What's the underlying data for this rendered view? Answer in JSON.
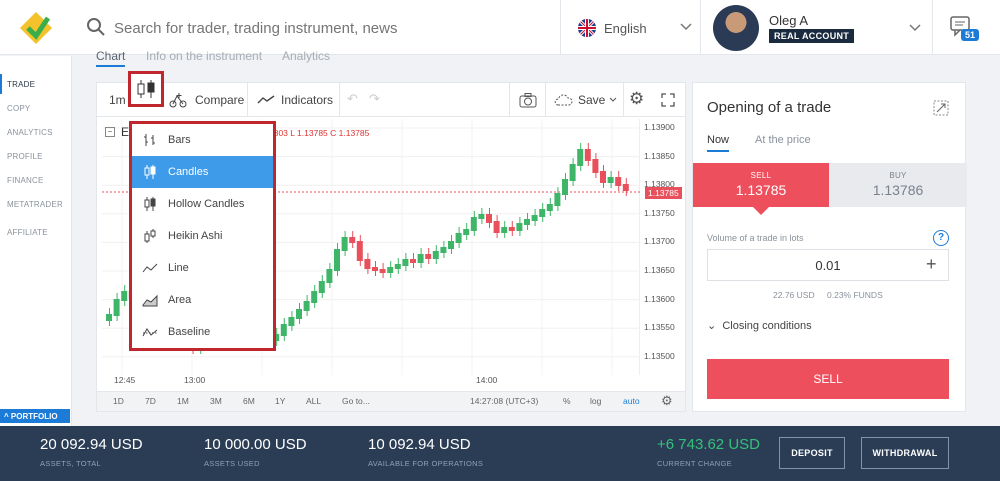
{
  "header": {
    "search_placeholder": "Search for trader, trading instrument, news",
    "language": "English",
    "user_name": "Oleg A",
    "account_type": "REAL ACCOUNT",
    "notifications_count": "51"
  },
  "sidebar": {
    "items": [
      "TRADE",
      "COPY",
      "ANALYTICS",
      "PROFILE",
      "FINANCE",
      "METATRADER",
      "AFFILIATE"
    ],
    "portfolio_label": "PORTFOLIO"
  },
  "tabs": [
    "Chart",
    "Info on the instrument",
    "Analytics"
  ],
  "chart": {
    "interval": "1m",
    "compare_label": "Compare",
    "indicators_label": "Indicators",
    "save_label": "Save",
    "symbol_initial": "E",
    "ohlc_text": "3803  L 1.13785  C 1.13785",
    "current_price": "1.13785",
    "price_labels": [
      "1.13900",
      "1.13850",
      "1.13800",
      "1.13750",
      "1.13700",
      "1.13650",
      "1.13600",
      "1.13550",
      "1.13500"
    ],
    "time_labels": [
      "12:45",
      "13:00",
      "14:00"
    ],
    "ranges": [
      "1D",
      "7D",
      "1M",
      "3M",
      "6M",
      "1Y",
      "ALL",
      "Go to..."
    ],
    "clock": "14:27:08 (UTC+3)",
    "pct_label": "%",
    "log_label": "log",
    "auto_label": "auto",
    "type_menu": [
      "Bars",
      "Candles",
      "Hollow Candles",
      "Heikin Ashi",
      "Line",
      "Area",
      "Baseline"
    ],
    "selected_type": "Candles"
  },
  "trade": {
    "title": "Opening of a trade",
    "tab_now": "Now",
    "tab_price": "At the price",
    "sell_label": "SELL",
    "sell_price": "1.13785",
    "buy_label": "BUY",
    "buy_price": "1.13786",
    "volume_label": "Volume of a trade in lots",
    "volume_value": "0.01",
    "funds_usd": "22.76 USD",
    "funds_pct": "0.23% FUNDS",
    "closing_label": "Closing conditions",
    "sell_button": "SELL"
  },
  "footer": {
    "assets_total": "20 092.94 USD",
    "assets_total_label": "ASSETS, TOTAL",
    "assets_used": "10 000.00 USD",
    "assets_used_label": "ASSETS USED",
    "available": "10 092.94 USD",
    "available_label": "AVAILABLE FOR OPERATIONS",
    "change": "+6 743.62 USD",
    "change_label": "CURRENT CHANGE",
    "deposit": "DEPOSIT",
    "withdrawal": "WITHDRAWAL"
  },
  "colors": {
    "accent": "#1d7bd8",
    "sell": "#ee4f5d",
    "up_candle": "#3fb568",
    "down_candle": "#e8505b",
    "highlight": "#c0262d"
  },
  "icons": [
    "logo",
    "search-icon",
    "uk-flag-icon",
    "chevron-down-icon",
    "chat-icon",
    "candles-icon",
    "compare-icon",
    "indicators-icon",
    "undo-icon",
    "redo-icon",
    "camera-icon",
    "cloud-icon",
    "gear-icon",
    "fullscreen-icon",
    "expand-icon",
    "help-icon",
    "plus-icon"
  ]
}
